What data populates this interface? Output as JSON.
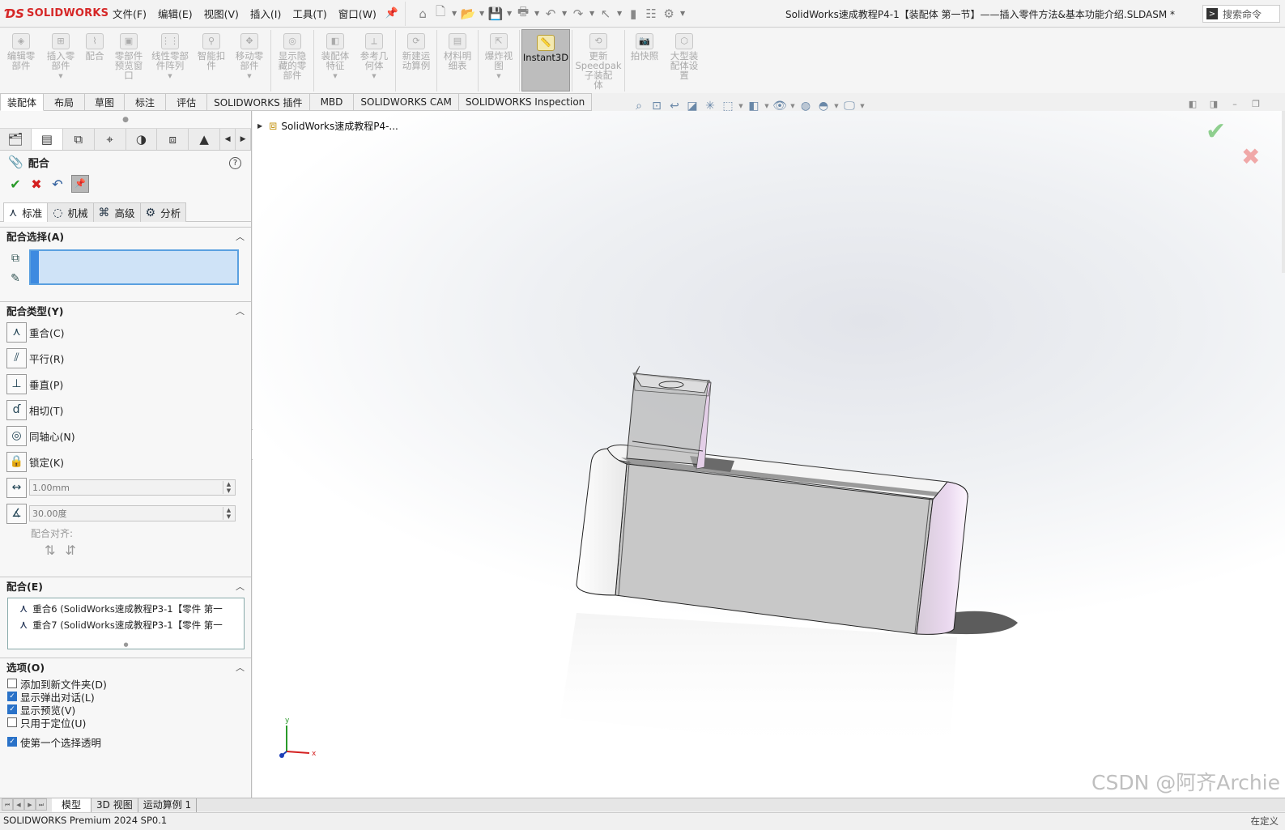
{
  "app": {
    "brand": "SOLIDWORKS",
    "document_title": "SolidWorks速成教程P4-1【装配体  第一节】——插入零件方法&基本功能介绍.SLDASM *",
    "search_label": "搜索命令"
  },
  "menus": [
    "文件(F)",
    "编辑(E)",
    "视图(V)",
    "插入(I)",
    "工具(T)",
    "窗口(W)"
  ],
  "command_manager": {
    "buttons": [
      {
        "label": "编辑零\n部件"
      },
      {
        "label": "插入零\n部件"
      },
      {
        "label": "配合"
      },
      {
        "label": "零部件\n预览窗\n口"
      },
      {
        "label": "线性零部\n件阵列"
      },
      {
        "label": "智能扣\n件"
      },
      {
        "label": "移动零\n部件"
      },
      {
        "label": "显示隐\n藏的零\n部件"
      },
      {
        "label": "装配体\n特征"
      },
      {
        "label": "参考几\n何体"
      },
      {
        "label": "新建运\n动算例"
      },
      {
        "label": "材料明\n细表"
      },
      {
        "label": "爆炸视\n图"
      },
      {
        "label": "Instant3D"
      },
      {
        "label": "更新\nSpeedpak\n子装配\n体"
      },
      {
        "label": "拍快照"
      },
      {
        "label": "大型装\n配体设\n置"
      }
    ],
    "tabs": [
      "装配体",
      "布局",
      "草图",
      "标注",
      "评估",
      "SOLIDWORKS 插件",
      "MBD",
      "SOLIDWORKS CAM",
      "SOLIDWORKS Inspection"
    ]
  },
  "property_manager": {
    "title": "配合",
    "help": "?",
    "subtabs": [
      "标准",
      "机械",
      "高级",
      "分析"
    ],
    "mate_selection": {
      "header": "配合选择(A)"
    },
    "mate_types": {
      "header": "配合类型(Y)",
      "items": [
        "重合(C)",
        "平行(R)",
        "垂直(P)",
        "相切(T)",
        "同轴心(N)",
        "锁定(K)"
      ],
      "distance": "1.00mm",
      "angle": "30.00度",
      "alignment_label": "配合对齐:"
    },
    "mates": {
      "header": "配合(E)",
      "items": [
        "重合6 (SolidWorks速成教程P3-1【零件  第一",
        "重合7 (SolidWorks速成教程P3-1【零件  第一"
      ]
    },
    "options": {
      "header": "选项(O)",
      "items": [
        {
          "label": "添加到新文件夹(D)",
          "checked": false
        },
        {
          "label": "显示弹出对话(L)",
          "checked": true
        },
        {
          "label": "显示预览(V)",
          "checked": true
        },
        {
          "label": "只用于定位(U)",
          "checked": false
        },
        {
          "label": "使第一个选择透明",
          "checked": true
        }
      ]
    }
  },
  "graphics": {
    "tree_node": "SolidWorks速成教程P4-...",
    "triad": {
      "x": "x",
      "y": "y"
    },
    "watermark": "CSDN @阿齐Archie"
  },
  "bottom_tabs": [
    "模型",
    "3D 视图",
    "运动算例 1"
  ],
  "status": {
    "left": "SOLIDWORKS Premium 2024 SP0.1",
    "right": "在定义"
  }
}
